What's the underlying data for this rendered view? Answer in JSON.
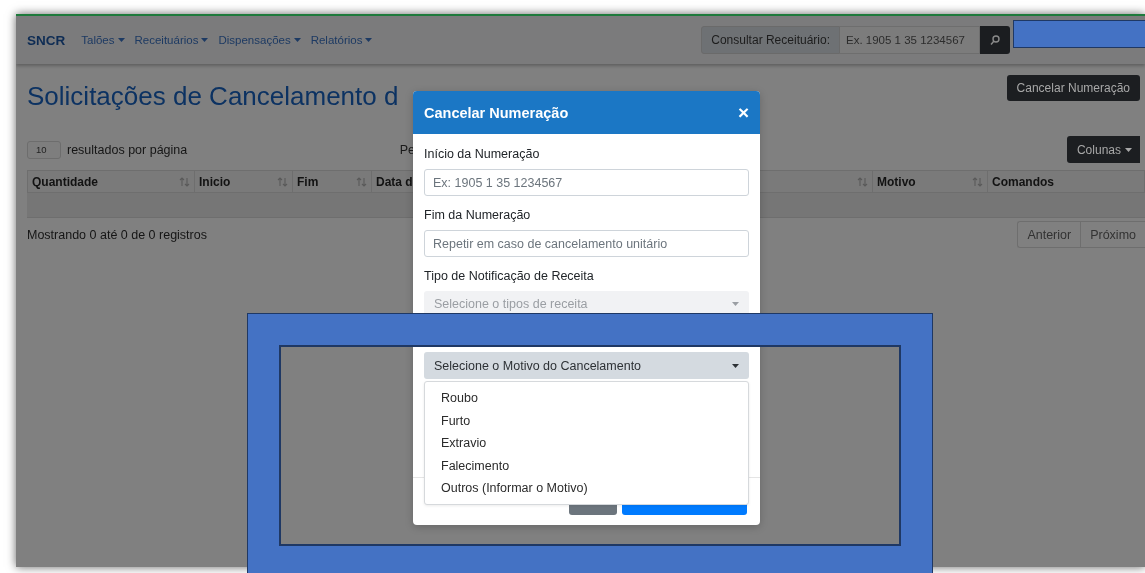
{
  "navbar": {
    "brand": "SNCR",
    "menus": [
      {
        "label": "Talões"
      },
      {
        "label": "Receituários"
      },
      {
        "label": "Dispensações"
      },
      {
        "label": "Relatórios"
      }
    ],
    "search": {
      "label": "Consultar Receituário:",
      "placeholder": "Ex. 1905 1 35 1234567"
    }
  },
  "page": {
    "title": "Solicitações de Cancelamento d",
    "action_button": "Cancelar Numeração",
    "page_length": "10",
    "page_length_label": "resultados por página",
    "search_label": "Pe",
    "columns_button": "Colunas"
  },
  "table": {
    "columns": [
      {
        "label": "Quantidade",
        "sortable": true
      },
      {
        "label": "Inicio",
        "sortable": true
      },
      {
        "label": "Fim",
        "sortable": true
      },
      {
        "label": "Data d"
      },
      {
        "sortable": true
      },
      {
        "label": "Motivo",
        "sortable": true
      },
      {
        "label": "Comandos",
        "sortable": false
      }
    ],
    "info": "Mostrando 0 até 0 de 0 registros",
    "pagination": [
      "Anterior",
      "Próximo"
    ]
  },
  "modal": {
    "title": "Cancelar Numeração",
    "close": "×",
    "fields": [
      {
        "kind": "input",
        "label": "Início da Numeração",
        "placeholder": "Ex: 1905 1 35 1234567"
      },
      {
        "kind": "input",
        "label": "Fim da Numeração",
        "placeholder": "Repetir em caso de cancelamento unitário"
      },
      {
        "kind": "select",
        "label": "Tipo de Notificação de Receita",
        "placeholder": "Selecione o tipos de receita",
        "disabled": true
      },
      {
        "kind": "select",
        "placeholder": "Selecione o Motivo do Cancelamento",
        "disabled": false,
        "open": true,
        "options": [
          "Roubo",
          "Furto",
          "Extravio",
          "Falecimento",
          "Outros (Informar o Motivo)"
        ]
      }
    ],
    "buttons": [
      {
        "kind": "secondary"
      },
      {
        "kind": "primary"
      }
    ]
  }
}
